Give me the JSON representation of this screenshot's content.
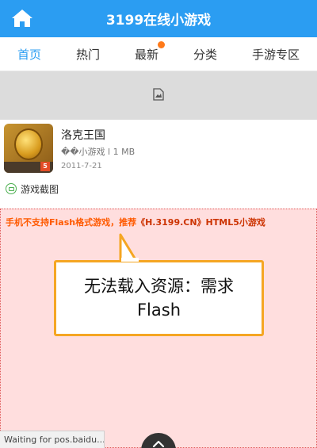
{
  "header": {
    "title": "3199在线小游戏",
    "home_icon": "home-icon"
  },
  "nav": {
    "items": [
      {
        "label": "首页",
        "active": true
      },
      {
        "label": "热门",
        "active": false
      },
      {
        "label": "最新",
        "active": false,
        "dot": true
      },
      {
        "label": "分类",
        "active": false
      },
      {
        "label": "手游专区",
        "active": false
      }
    ]
  },
  "banner": {
    "icon": "broken-image-icon"
  },
  "game": {
    "name": "洛克王国",
    "meta": "��小游戏 l 1 MB",
    "date": "2011-7-21",
    "badge": "5"
  },
  "screenshots": {
    "label": "游戏截图"
  },
  "flash": {
    "notice_prefix": "手机不支持Flash格式游戏，推荐",
    "notice_link": "《H.3199.CN》HTML5小游戏",
    "callout_line1": "无法载入资源：需求",
    "callout_line2": "Flash"
  },
  "status": {
    "text": "Waiting for pos.baidu..."
  },
  "colors": {
    "accent": "#2b9df2",
    "orange": "#ff5a00",
    "callout_border": "#f5a623",
    "flash_bg": "#ffdede"
  }
}
